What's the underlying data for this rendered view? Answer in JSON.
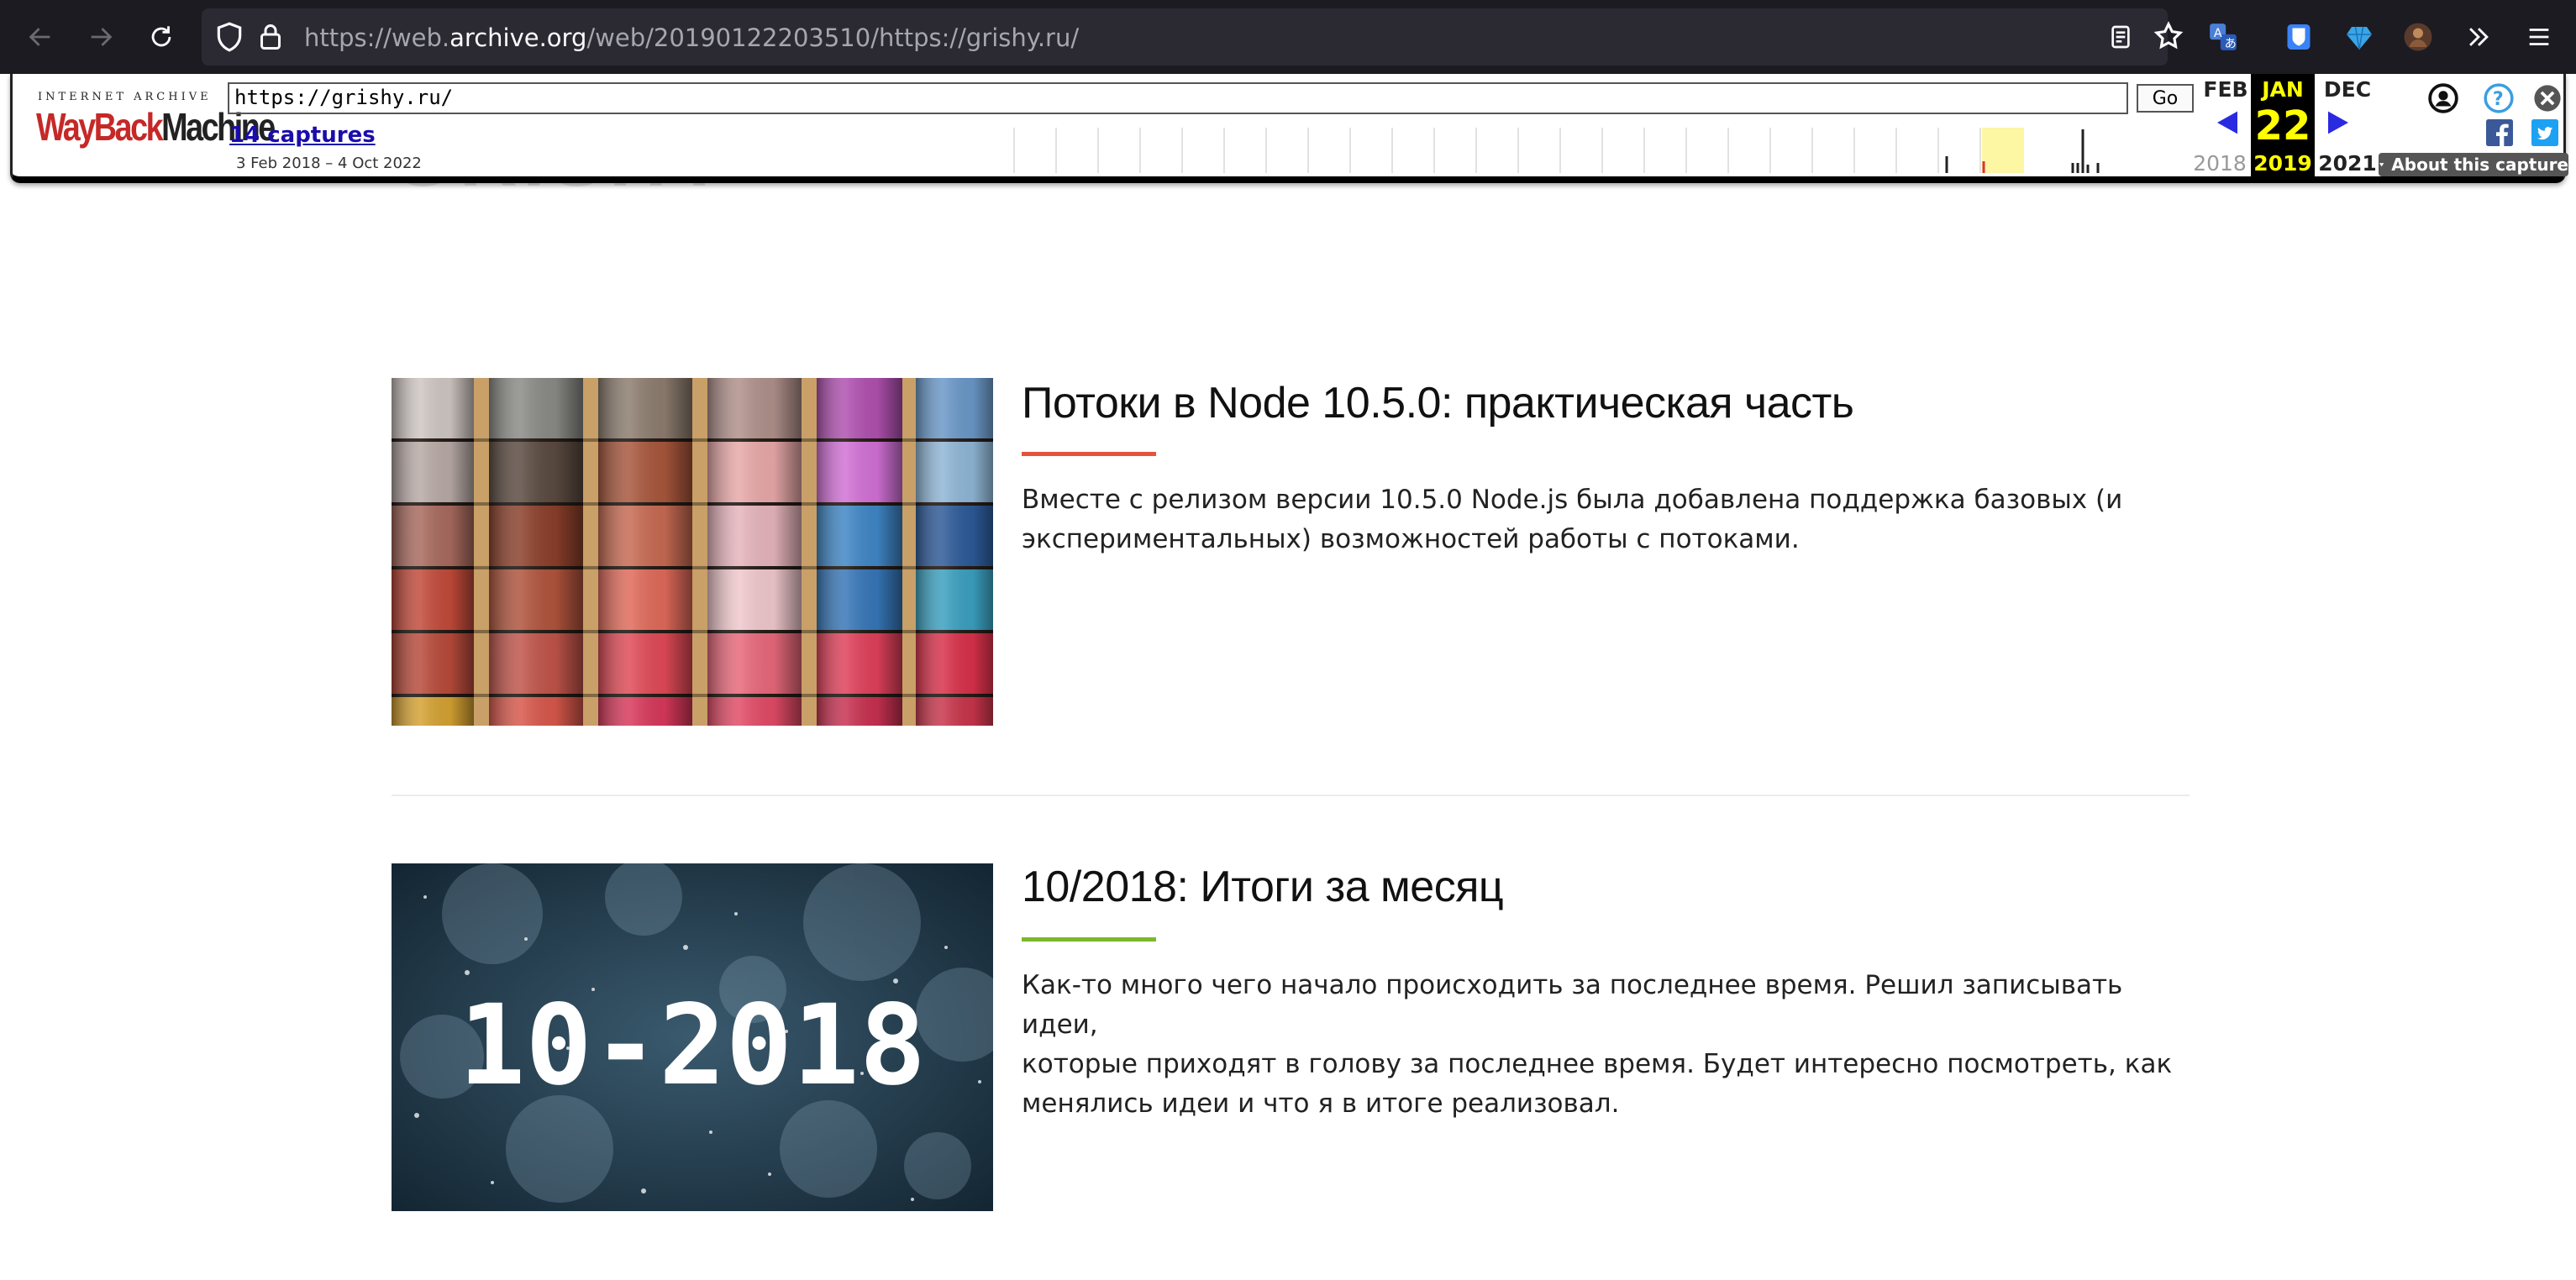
{
  "browser": {
    "url_prefix": "https://web.",
    "url_domain": "archive.org",
    "url_suffix": "/web/20190122203510/https://grishy.ru/"
  },
  "wayback": {
    "logo_top": "INTERNET ARCHIVE",
    "logo_wayback": "WayBack",
    "logo_machine": "Machine",
    "url_value": "https://grishy.ru/",
    "go_label": "Go",
    "captures_label": "14 captures",
    "date_range": "3 Feb 2018 – 4 Oct 2022",
    "prev_month": "FEB",
    "cur_month": "JAN",
    "next_month": "DEC",
    "day": "22",
    "prev_year": "2018",
    "cur_year": "2019",
    "next_year": "2021",
    "about_label": "About this capture"
  },
  "site": {
    "title": "GRISHY"
  },
  "posts": [
    {
      "title": "Потоки в Node 10.5.0: практическая часть",
      "line1": "Вместе с релизом версии 10.5.0 Node.js была добавлена поддержка базовых (и",
      "line2": "экспериментальных) возможностей работы с потоками.",
      "accent": "#e5533d"
    },
    {
      "title": "10/2018: Итоги за месяц",
      "image_text": "10-2018",
      "line1": "Как-то много чего начало происходить за последнее время. Решил записывать идеи,",
      "line2": "которые приходят в голову за последнее время. Будет интересно посмотреть, как",
      "line3": "менялись идеи и что я в итоге реализовал.",
      "accent": "#7cb82f"
    }
  ]
}
